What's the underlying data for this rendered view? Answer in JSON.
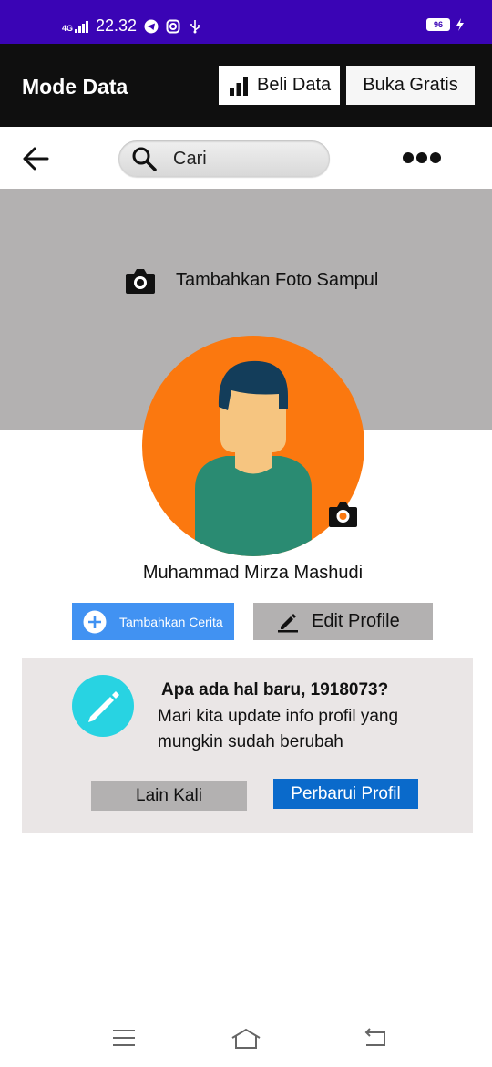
{
  "status_bar": {
    "network": "4G",
    "time": "22.32",
    "battery": "96"
  },
  "mode_bar": {
    "title": "Mode Data",
    "beli_label": "Beli Data",
    "buka_label": "Buka Gratis"
  },
  "nav": {
    "search_label": "Cari"
  },
  "cover": {
    "label": "Tambahkan Foto Sampul"
  },
  "profile": {
    "name": "Muhammad Mirza Mashudi",
    "story_button": "Tambahkan Cerita",
    "edit_button": "Edit Profile"
  },
  "prompt_card": {
    "question": "Apa ada hal baru, 1918073?",
    "description": "Mari kita update info profil yang mungkin sudah berubah",
    "later_button": "Lain Kali",
    "update_button": "Perbarui Profil"
  },
  "colors": {
    "status_bar": "#3a04b5",
    "mode_bar": "#0f0f0f",
    "cover": "#b3b1b1",
    "avatar_bg": "#fb780f",
    "story_button": "#4192f2",
    "update_button": "#0a6acb",
    "card_bg": "#eae6e6",
    "pencil_circle": "#28d3e2"
  }
}
